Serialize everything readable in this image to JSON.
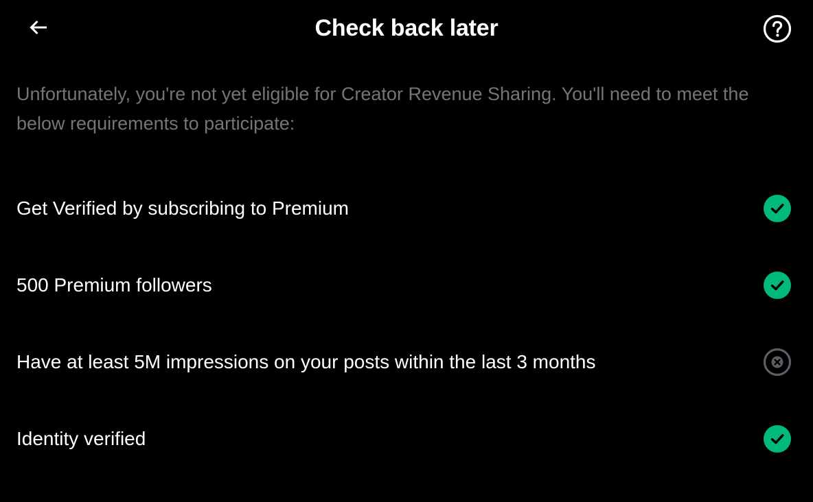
{
  "header": {
    "back_icon": "arrow-left-icon",
    "title": "Check back later",
    "help_icon": "question-circle-icon"
  },
  "intro": "Unfortunately, you're not yet eligible for Creator Revenue Sharing. You'll need to meet the below requirements to participate:",
  "requirements": [
    {
      "label": "Get Verified by subscribing to Premium",
      "status": "met",
      "icon": "check-circle-icon"
    },
    {
      "label": "500 Premium followers",
      "status": "met",
      "icon": "check-circle-icon"
    },
    {
      "label": "Have at least 5M impressions on your posts within the last 3 months",
      "status": "not-met",
      "icon": "x-circle-icon"
    },
    {
      "label": "Identity verified",
      "status": "met",
      "icon": "check-circle-icon"
    }
  ],
  "colors": {
    "background": "#000000",
    "text_primary": "#ffffff",
    "text_secondary": "#71767b",
    "met": "#00ba7c",
    "not_met": "#71767b"
  }
}
